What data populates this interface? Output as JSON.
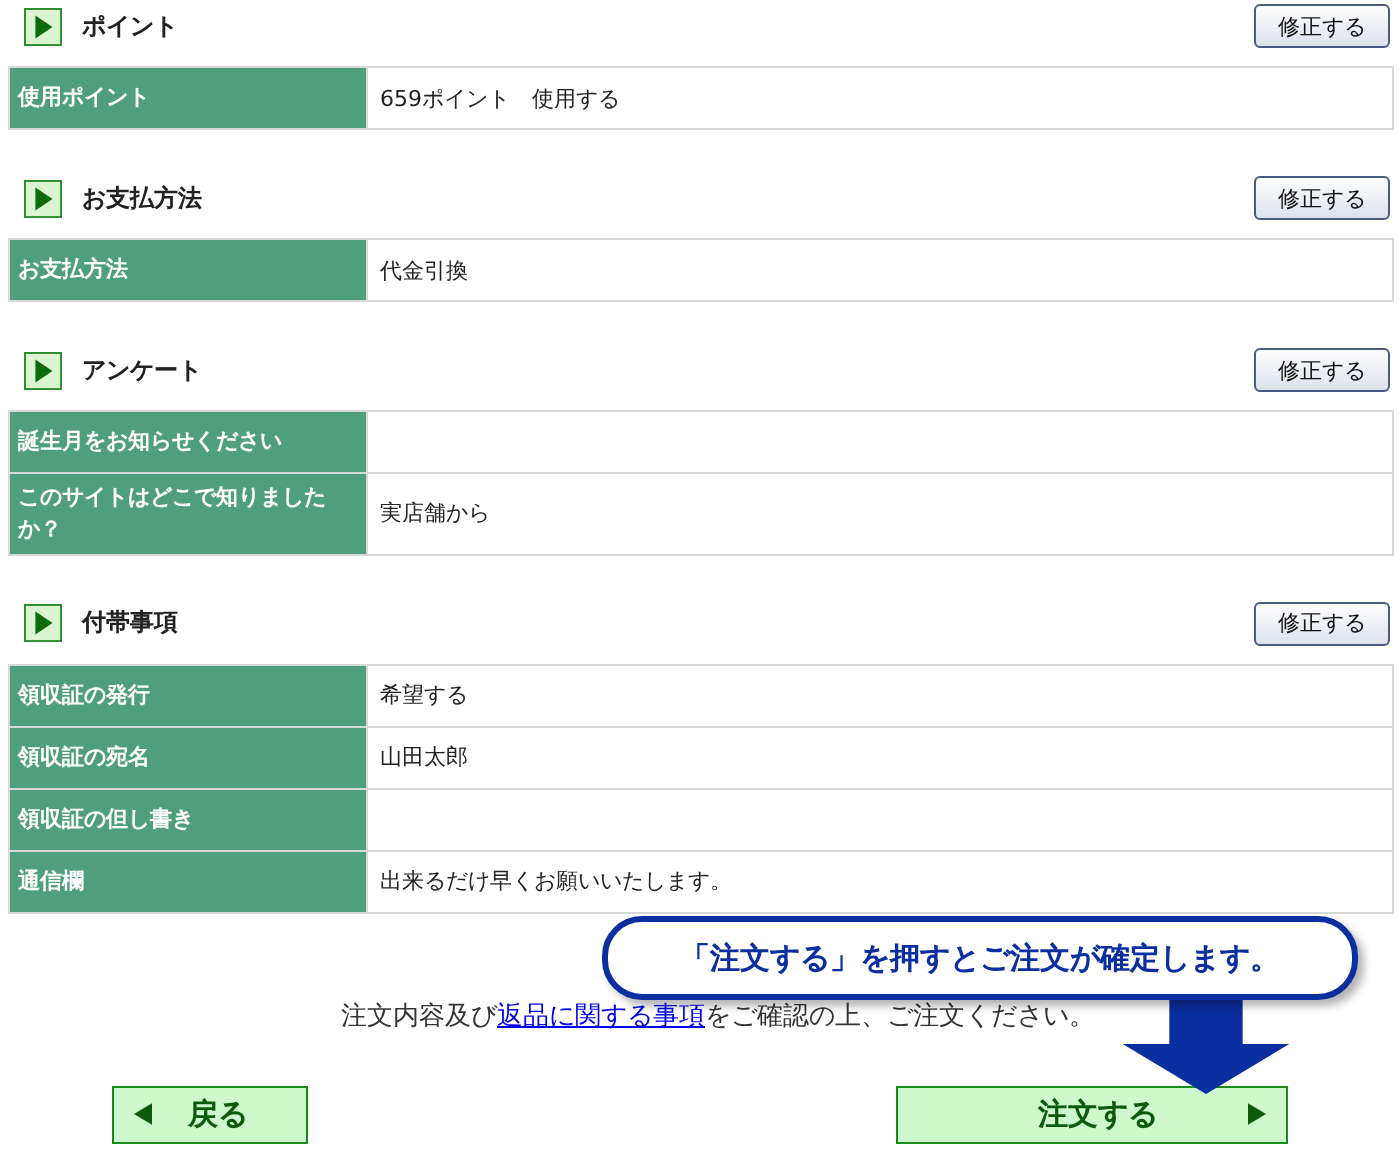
{
  "sections": [
    {
      "title": "ポイント",
      "edit_button": "修正する",
      "rows": [
        {
          "label": "使用ポイント",
          "value": "659ポイント　使用する"
        }
      ]
    },
    {
      "title": "お支払方法",
      "edit_button": "修正する",
      "rows": [
        {
          "label": "お支払方法",
          "value": "代金引換"
        }
      ]
    },
    {
      "title": "アンケート",
      "edit_button": "修正する",
      "rows": [
        {
          "label": "誕生月をお知らせください",
          "value": ""
        },
        {
          "label": "このサイトはどこで知りましたか？",
          "value": "実店舗から"
        }
      ]
    },
    {
      "title": "付帯事項",
      "edit_button": "修正する",
      "rows": [
        {
          "label": "領収証の発行",
          "value": "希望する"
        },
        {
          "label": "領収証の宛名",
          "value": "山田太郎"
        },
        {
          "label": "領収証の但し書き",
          "value": ""
        },
        {
          "label": "通信欄",
          "value": "出来るだけ早くお願いいたします。"
        }
      ]
    }
  ],
  "notice": {
    "before": "注文内容及び",
    "link": "返品に関する事項",
    "after": "をご確認の上、ご注文ください。"
  },
  "callout": "「注文する」を押すとご注文が確定します。",
  "back_button": "戻る",
  "order_button": "注文する"
}
